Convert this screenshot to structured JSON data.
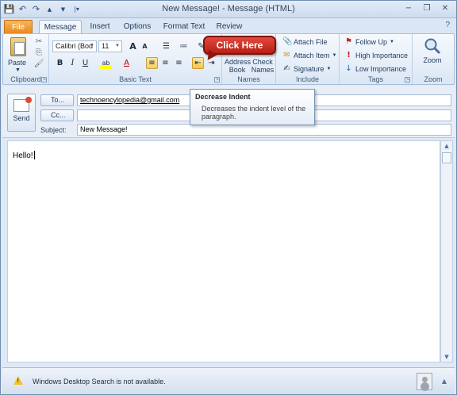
{
  "window": {
    "title": "New Message! - Message (HTML)",
    "controls": {
      "minimize": "−",
      "restore": "❐",
      "close": "✕"
    }
  },
  "qat": {
    "save": "💾",
    "undo": "↶",
    "redo": "↷",
    "up": "▲",
    "down": "▼",
    "customize": "|▾"
  },
  "tabs": [
    {
      "label": "File"
    },
    {
      "label": "Message"
    },
    {
      "label": "Insert"
    },
    {
      "label": "Options"
    },
    {
      "label": "Format Text"
    },
    {
      "label": "Review"
    }
  ],
  "help": "?",
  "ribbon": {
    "clipboard": {
      "label": "Clipboard",
      "paste": "Paste",
      "cut": "✂",
      "copy": "⎘",
      "format_painter": "🖌"
    },
    "basic_text": {
      "label": "Basic Text",
      "font": "Calibri (Bod",
      "size": "11",
      "grow": "A",
      "shrink": "A",
      "bold": "B",
      "italic": "I",
      "underline": "U",
      "highlight": "ab",
      "font_color": "A",
      "eraser": "✎"
    },
    "names": {
      "label": "Names",
      "address_book": "Address Book",
      "check_names": "Check Names"
    },
    "include": {
      "label": "Include",
      "attach_file": "Attach File",
      "attach_item": "Attach Item",
      "signature": "Signature"
    },
    "tags": {
      "label": "Tags",
      "follow_up": "Follow Up",
      "high": "High Importance",
      "low": "Low Importance"
    },
    "zoom": {
      "label": "Zoom",
      "button": "Zoom"
    }
  },
  "callout": {
    "text": "Click Here"
  },
  "tooltip": {
    "title": "Decrease Indent",
    "body": "Decreases the indent level of the paragraph."
  },
  "compose": {
    "send": "Send",
    "to_label": "To...",
    "cc_label": "Cc...",
    "subject_label": "Subject:",
    "to_value": "technoencylopedia@gmail.com",
    "cc_value": "",
    "subject_value": "New Message!"
  },
  "body": {
    "text": "Hello!"
  },
  "status": {
    "message": "Windows Desktop Search is not available."
  },
  "colors": {
    "file_tab": "#e8891e",
    "callout": "#c9281c",
    "ribbon": "#dbe7f5",
    "frame": "#dfe9f5"
  }
}
